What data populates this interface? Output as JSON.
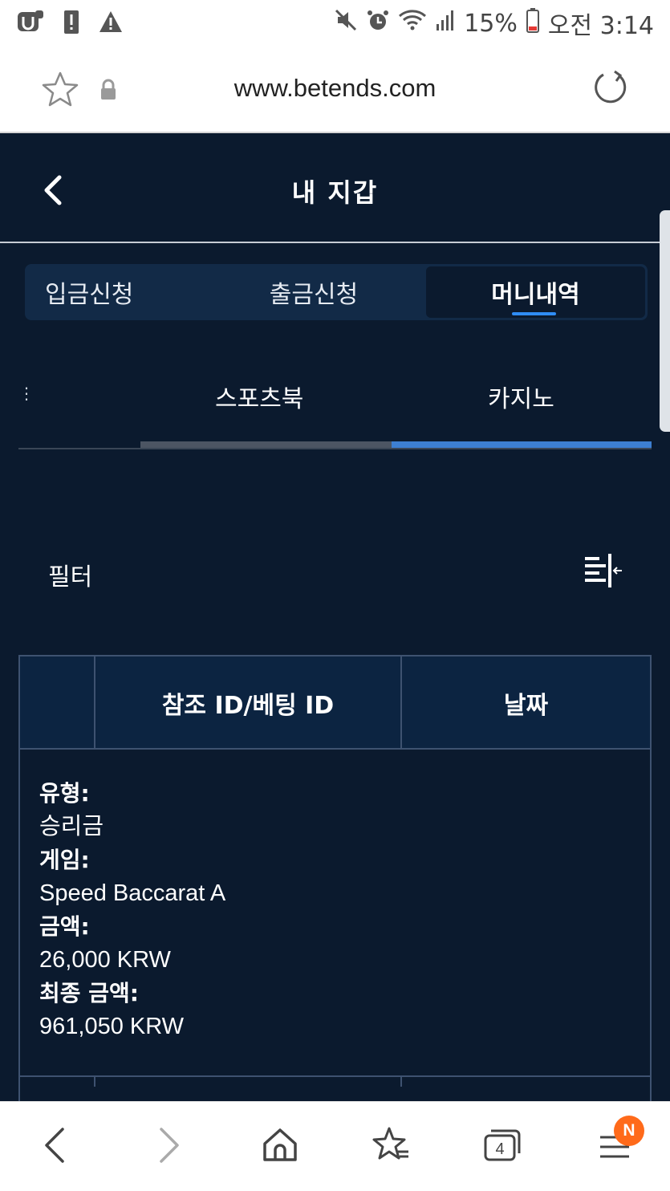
{
  "status_bar": {
    "battery": "15%",
    "time": "오전 3:14"
  },
  "browser": {
    "url": "www.betends.com"
  },
  "header": {
    "title": "내 지갑"
  },
  "wallet_tabs": [
    {
      "label": "입금신청"
    },
    {
      "label": "출금신청"
    },
    {
      "label": "머니내역"
    }
  ],
  "sub_tabs": {
    "overflow": "⋮",
    "items": [
      {
        "label": "스포츠북"
      },
      {
        "label": "카지노"
      }
    ]
  },
  "filter": {
    "label": "필터"
  },
  "table": {
    "columns": [
      "",
      "참조 ID/베팅 ID",
      "날짜"
    ],
    "detail": {
      "type_label": "유형:",
      "type_value": "승리금",
      "game_label": "게임:",
      "game_value": "Speed Baccarat A",
      "amount_label": "금액:",
      "amount_value": "26,000 KRW",
      "final_label": "최종 금액:",
      "final_value": "961,050 KRW"
    }
  },
  "bottom_nav": {
    "tabs_count": "4",
    "badge": "N"
  },
  "colors": {
    "background": "#0b1a2e",
    "tab_bar": "#122a47",
    "accent_blue": "#3d7fd1",
    "badge": "#ff6a1a"
  }
}
